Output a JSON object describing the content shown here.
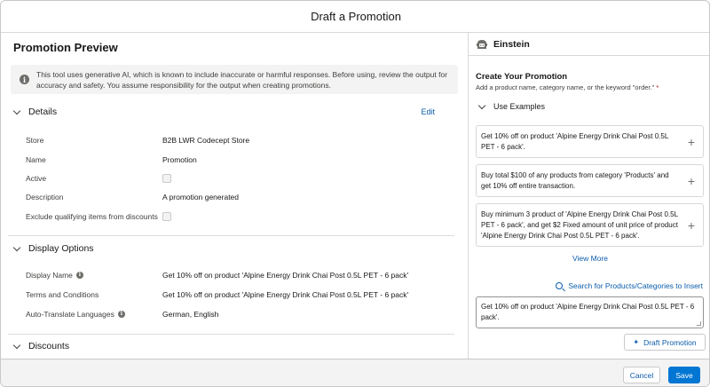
{
  "modal": {
    "title": "Draft a Promotion"
  },
  "preview": {
    "title": "Promotion Preview",
    "warning": "This tool uses generative AI, which is known to include inaccurate or harmful responses. Before using, review the output for accuracy and safety. You assume responsibility for the output when creating promotions.",
    "details": {
      "heading": "Details",
      "edit_label": "Edit",
      "fields": {
        "store": {
          "label": "Store",
          "value": "B2B LWR Codecept Store"
        },
        "name": {
          "label": "Name",
          "value": "Promotion"
        },
        "active": {
          "label": "Active",
          "checked": false
        },
        "description": {
          "label": "Description",
          "value": "A promotion generated"
        },
        "exclude": {
          "label": "Exclude qualifying items from discounts",
          "checked": false
        }
      }
    },
    "display_options": {
      "heading": "Display Options",
      "fields": {
        "display_name": {
          "label": "Display Name",
          "value": "Get 10% off on product 'Alpine Energy Drink Chai Post 0.5L PET - 6 pack'"
        },
        "terms": {
          "label": "Terms and Conditions",
          "value": "Get 10% off on product 'Alpine Energy Drink Chai Post 0.5L PET - 6 pack'"
        },
        "languages": {
          "label": "Auto-Translate Languages",
          "value": "German, English"
        }
      }
    },
    "discounts": {
      "heading": "Discounts"
    }
  },
  "einstein": {
    "title": "Einstein",
    "create_title": "Create Your Promotion",
    "create_subtitle": "Add a product name, category name, or the keyword \"order.\"",
    "required_mark": "*",
    "use_examples_label": "Use Examples",
    "examples": [
      "Get 10% off on product 'Alpine Energy Drink Chai Post 0.5L PET - 6 pack'.",
      "Buy total $100 of any products from category 'Products' and get 10% off entire transaction.",
      "Buy minimum 3 product of 'Alpine Energy Drink Chai Post 0.5L PET - 6 pack', and get $2 Fixed amount of unit price of product 'Alpine Energy Drink Chai Post 0.5L PET - 6 pack'."
    ],
    "add_symbol": "+",
    "view_more_label": "View More",
    "search_link_label": "Search for Products/Categories to Insert",
    "prompt_value": "Get 10% off on product 'Alpine Energy Drink Chai Post 0.5L PET - 6 pack'.",
    "draft_button_label": "Draft Promotion"
  },
  "footer": {
    "cancel_label": "Cancel",
    "save_label": "Save"
  },
  "colors": {
    "brand": "#0176d3",
    "link": "#0b5cab",
    "required": "#ba0517"
  },
  "icons": {
    "info": "info-icon",
    "help": "help-icon",
    "chevron": "chevron-icon",
    "einstein": "einstein-logo-icon",
    "plus": "plus-icon",
    "search": "search-icon",
    "sparkle": "sparkle-icon"
  }
}
